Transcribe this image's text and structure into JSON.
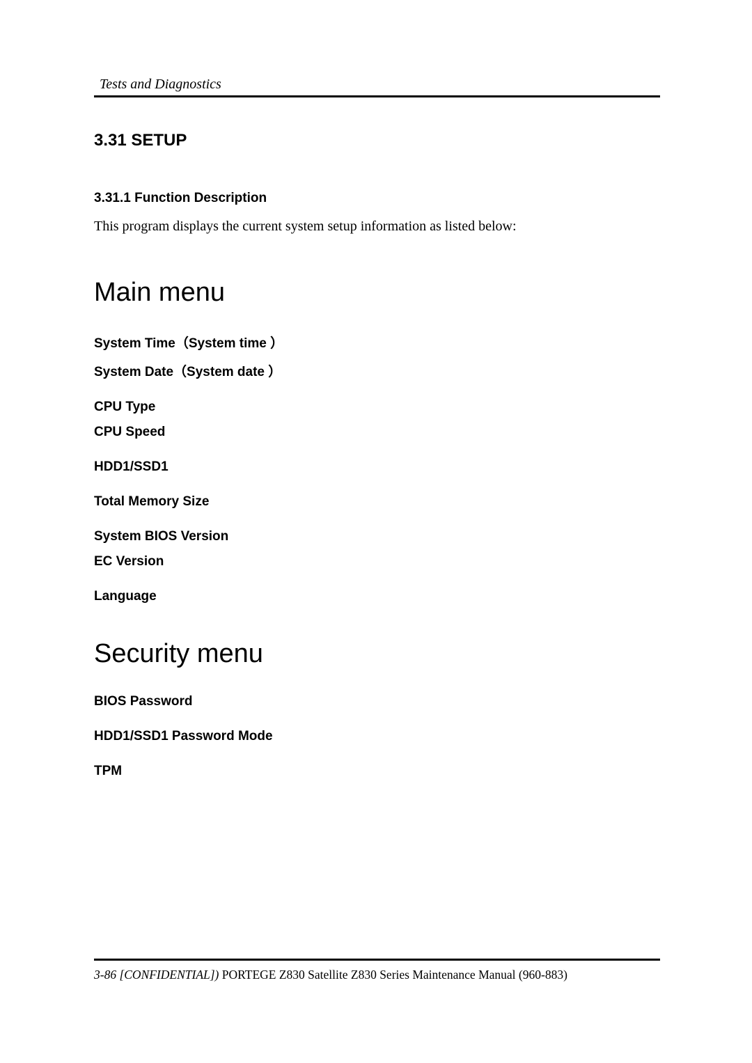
{
  "header": {
    "title": "Tests and Diagnostics"
  },
  "section": {
    "number_title": "3.31  SETUP",
    "subsection_number_title": "3.31.1  Function Description",
    "intro_text": "This program displays the current system setup information as listed below:"
  },
  "main_menu": {
    "heading": "Main menu",
    "items": {
      "system_time": "System Time（System time ）",
      "system_date": "System Date（System date ）",
      "cpu_type": "CPU Type",
      "cpu_speed": "CPU Speed",
      "hdd_ssd": "HDD1/SSD1",
      "total_memory": "Total Memory Size",
      "bios_version": "System BIOS Version",
      "ec_version": "EC Version",
      "language": "Language"
    }
  },
  "security_menu": {
    "heading": "Security menu",
    "items": {
      "bios_password": "BIOS Password",
      "hdd_password_mode": "HDD1/SSD1 Password Mode",
      "tpm": "TPM"
    }
  },
  "footer": {
    "page_label_italic": "3-86 [CONFIDENTIAL])",
    "manual_title": " PORTEGE Z830 Satellite Z830 Series Maintenance Manual (960-883)"
  }
}
